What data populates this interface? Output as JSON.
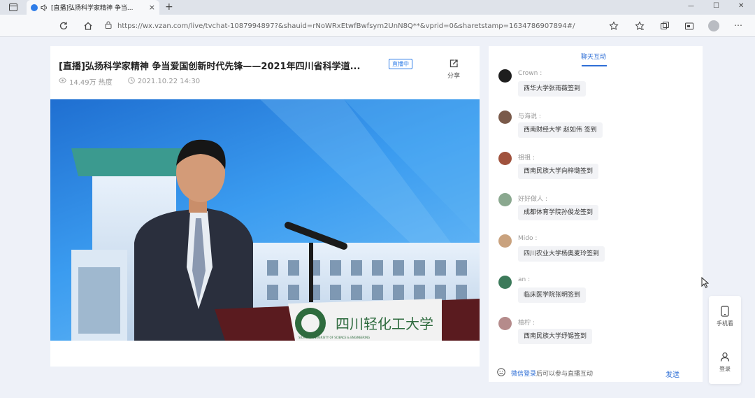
{
  "browser": {
    "tab_title": "[直播]弘扬科学家精神 争当...",
    "new_tab_symbol": "+",
    "close_tab_symbol": "×",
    "url": "https://wx.vzan.com/live/tvchat-1087994897?&shauid=rNoWRxEtwfBwfsym2UnN8Q**&vprid=0&sharetstamp=1634786907894#/",
    "window_controls": {
      "minimize": "—",
      "maximize": "☐",
      "close": "✕"
    }
  },
  "live": {
    "title": "[直播]弘扬科学家精神 争当爱国创新时代先锋——2021年四川省科学道...",
    "badge": "直播中",
    "views": "14.49万 热度",
    "datetime": "2021.10.22 14:30",
    "share_label": "分享",
    "podium_text": "四川轻化工大学",
    "podium_subtext": "SICHUAN UNIVERSITY OF SCIENCE & ENGINEERING"
  },
  "chat": {
    "tab_label": "聊天互动",
    "messages": [
      {
        "user": "Crown :",
        "text": "西华大学张雨薇签到",
        "avatar_color": "#1e1e1e"
      },
      {
        "user": "与海说 :",
        "text": "西南财经大学 赵如伟 签到",
        "avatar_color": "#7a5a4a"
      },
      {
        "user": "祖祖 :",
        "text": "西南民族大学向梓璐签到",
        "avatar_color": "#a0523d"
      },
      {
        "user": "好好做人 :",
        "text": "成都体育学院孙俊龙签到",
        "avatar_color": "#8aa88f"
      },
      {
        "user": "Mido :",
        "text": "四川农业大学杨奥麦玲签到",
        "avatar_color": "#c9a27e"
      },
      {
        "user": "an :",
        "text": "临床医学院张明签到",
        "avatar_color": "#3c7a5a"
      },
      {
        "user": "柚柠 :",
        "text": "西南民族大学纾锡签到",
        "avatar_color": "#b58b8b"
      }
    ],
    "input_hint_link": "微信登录",
    "input_hint_text": "后可以参与直播互动",
    "send_label": "发送"
  },
  "float": {
    "mobile_label": "手机看",
    "login_label": "登录"
  }
}
